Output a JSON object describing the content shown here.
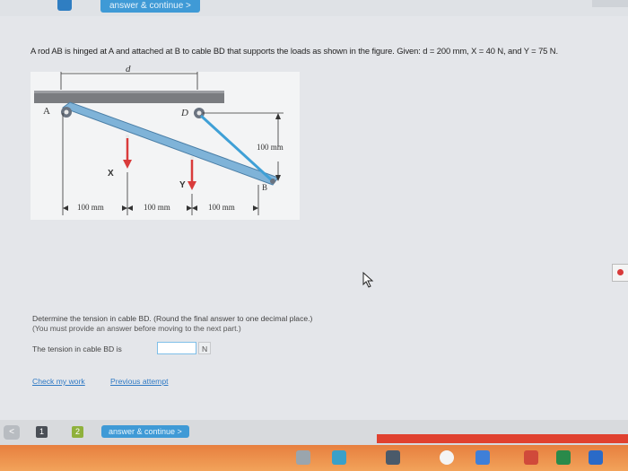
{
  "topbar": {
    "continue_label": "answer & continue >"
  },
  "problem": {
    "text": "A rod AB is hinged at A and attached at B to cable BD that supports the loads as shown in the figure. Given: d = 200 mm, X = 40 N, and Y = 75 N."
  },
  "figure": {
    "label_A": "A",
    "label_D": "D",
    "label_B": "B",
    "label_d": "d",
    "label_X": "X",
    "label_Y": "Y",
    "dim_vertical": "100 mm",
    "dim_1": "100 mm",
    "dim_2": "100 mm",
    "dim_3": "100 mm"
  },
  "question": {
    "determine": "Determine the tension in cable BD. (Round the final answer to one decimal place.)",
    "must_provide": "(You must provide an answer before moving to the next part.)",
    "answer_label": "The tension in cable BD is",
    "answer_value": "",
    "unit": "N"
  },
  "links": {
    "check": "Check my work",
    "previous": "Previous attempt"
  },
  "bottom": {
    "back": "<",
    "page_1": "1",
    "page_2": "2",
    "continue_label": "answer & continue >"
  },
  "colors": {
    "accent": "#3f9ad6",
    "rod": "#7fb3d8",
    "force": "#d93b3b",
    "taskbar": "#e77f3f"
  }
}
